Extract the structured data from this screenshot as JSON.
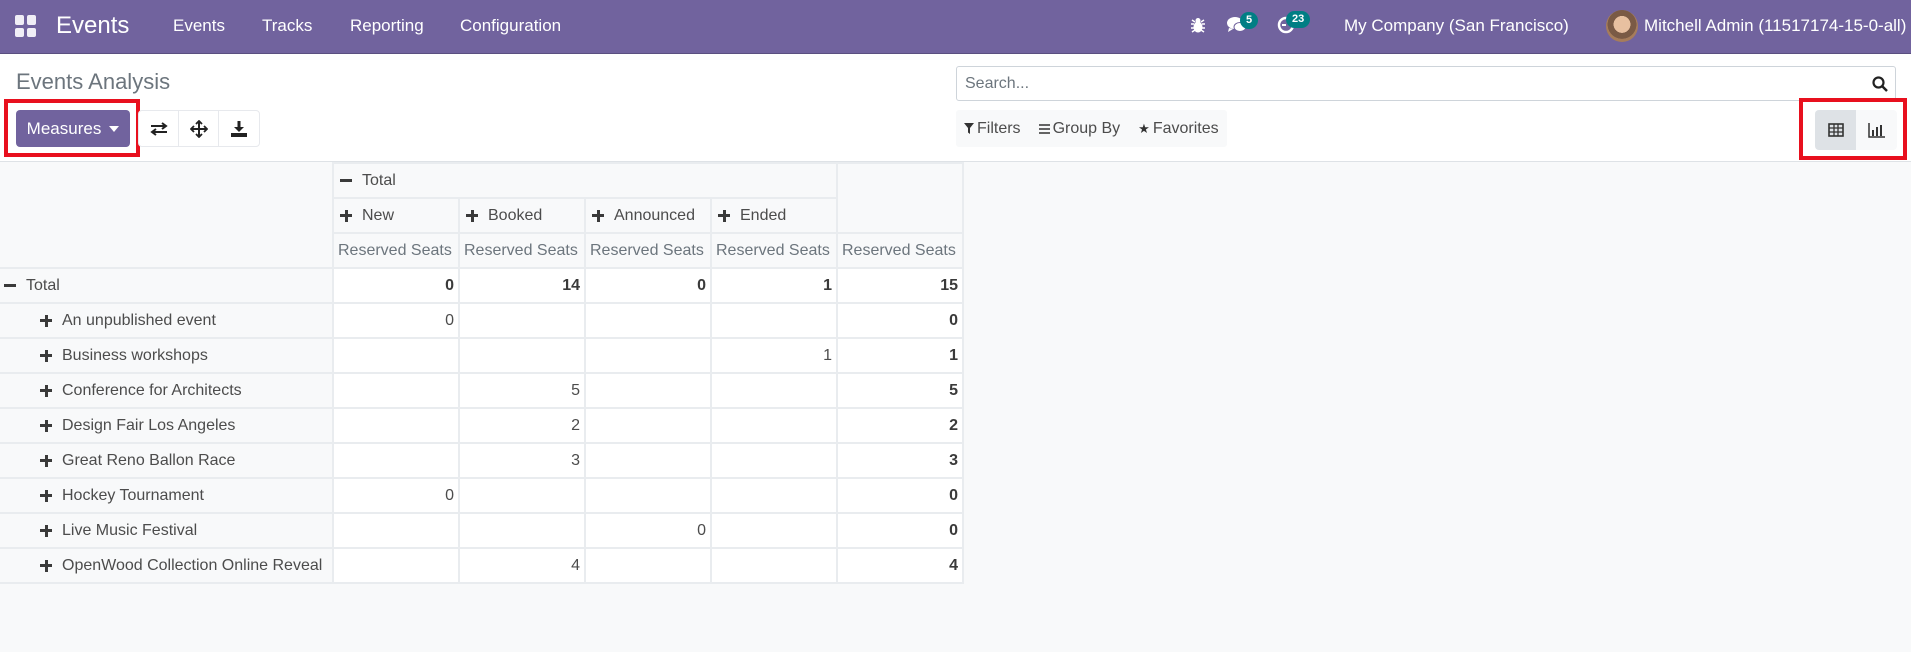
{
  "navbar": {
    "app_name": "Events",
    "menu": [
      "Events",
      "Tracks",
      "Reporting",
      "Configuration"
    ],
    "icons": {
      "apps": "apps-grid-icon",
      "debug": "bug-icon",
      "messages": "chat-icon",
      "activities": "clock-icon"
    },
    "messages_badge": "5",
    "activities_badge": "23",
    "company": "My Company (San Francisco)",
    "user": "Mitchell Admin (11517174-15-0-all)",
    "color": "#71639e",
    "badge_color": "#017e84"
  },
  "control_panel": {
    "title": "Events Analysis",
    "measures_label": "Measures",
    "tools": [
      "flip-axis-icon",
      "expand-all-icon",
      "download-icon"
    ],
    "search": {
      "placeholder": "Search...",
      "value": ""
    },
    "filters_label": "Filters",
    "group_by_label": "Group By",
    "favorites_label": "Favorites",
    "views": [
      {
        "name": "pivot",
        "icon": "table-icon",
        "active": true
      },
      {
        "name": "graph",
        "icon": "bar-chart-icon",
        "active": false
      }
    ]
  },
  "pivot": {
    "col_root": "Total",
    "columns": [
      "New",
      "Booked",
      "Announced",
      "Ended"
    ],
    "measure": "Reserved Seats",
    "row_root": "Total",
    "totals": [
      "0",
      "14",
      "0",
      "1",
      "15"
    ],
    "rows": [
      {
        "label": "An unpublished event",
        "values": [
          "0",
          "",
          "",
          ""
        ],
        "total": "0"
      },
      {
        "label": "Business workshops",
        "values": [
          "",
          "",
          "",
          "1"
        ],
        "total": "1"
      },
      {
        "label": "Conference for Architects",
        "values": [
          "",
          "5",
          "",
          ""
        ],
        "total": "5"
      },
      {
        "label": "Design Fair Los Angeles",
        "values": [
          "",
          "2",
          "",
          ""
        ],
        "total": "2"
      },
      {
        "label": "Great Reno Ballon Race",
        "values": [
          "",
          "3",
          "",
          ""
        ],
        "total": "3"
      },
      {
        "label": "Hockey Tournament",
        "values": [
          "0",
          "",
          "",
          ""
        ],
        "total": "0"
      },
      {
        "label": "Live Music Festival",
        "values": [
          "",
          "",
          "0",
          ""
        ],
        "total": "0"
      },
      {
        "label": "OpenWood Collection Online Reveal",
        "values": [
          "",
          "4",
          "",
          ""
        ],
        "total": "4"
      }
    ]
  }
}
